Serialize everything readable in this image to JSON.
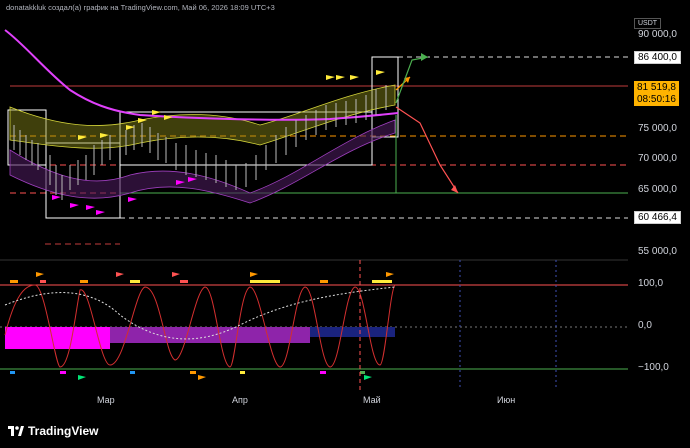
{
  "header": {
    "text": "donatakkluk создал(а) график на TradingView.com, Май 06, 2026 18:09 UTC+3"
  },
  "currency": "USDT",
  "price_axis": {
    "labels": [
      "90 000,0",
      "86 400,0",
      "81 519,8",
      "08:50:16",
      "75 000,0",
      "70 000,0",
      "65 000,0",
      "60 466,4",
      "55 000,0"
    ]
  },
  "osc_axis": {
    "labels": [
      "100,0",
      "0,0",
      "−100,0"
    ]
  },
  "time_axis": {
    "labels": [
      "Мар",
      "Апр",
      "Май",
      "Июн"
    ]
  },
  "footer": {
    "brand": "TradingView"
  },
  "colors": {
    "accent": "#ffb300",
    "magenta": "#ff00ff",
    "yellow": "#ffeb3b",
    "background": "#000000"
  }
}
